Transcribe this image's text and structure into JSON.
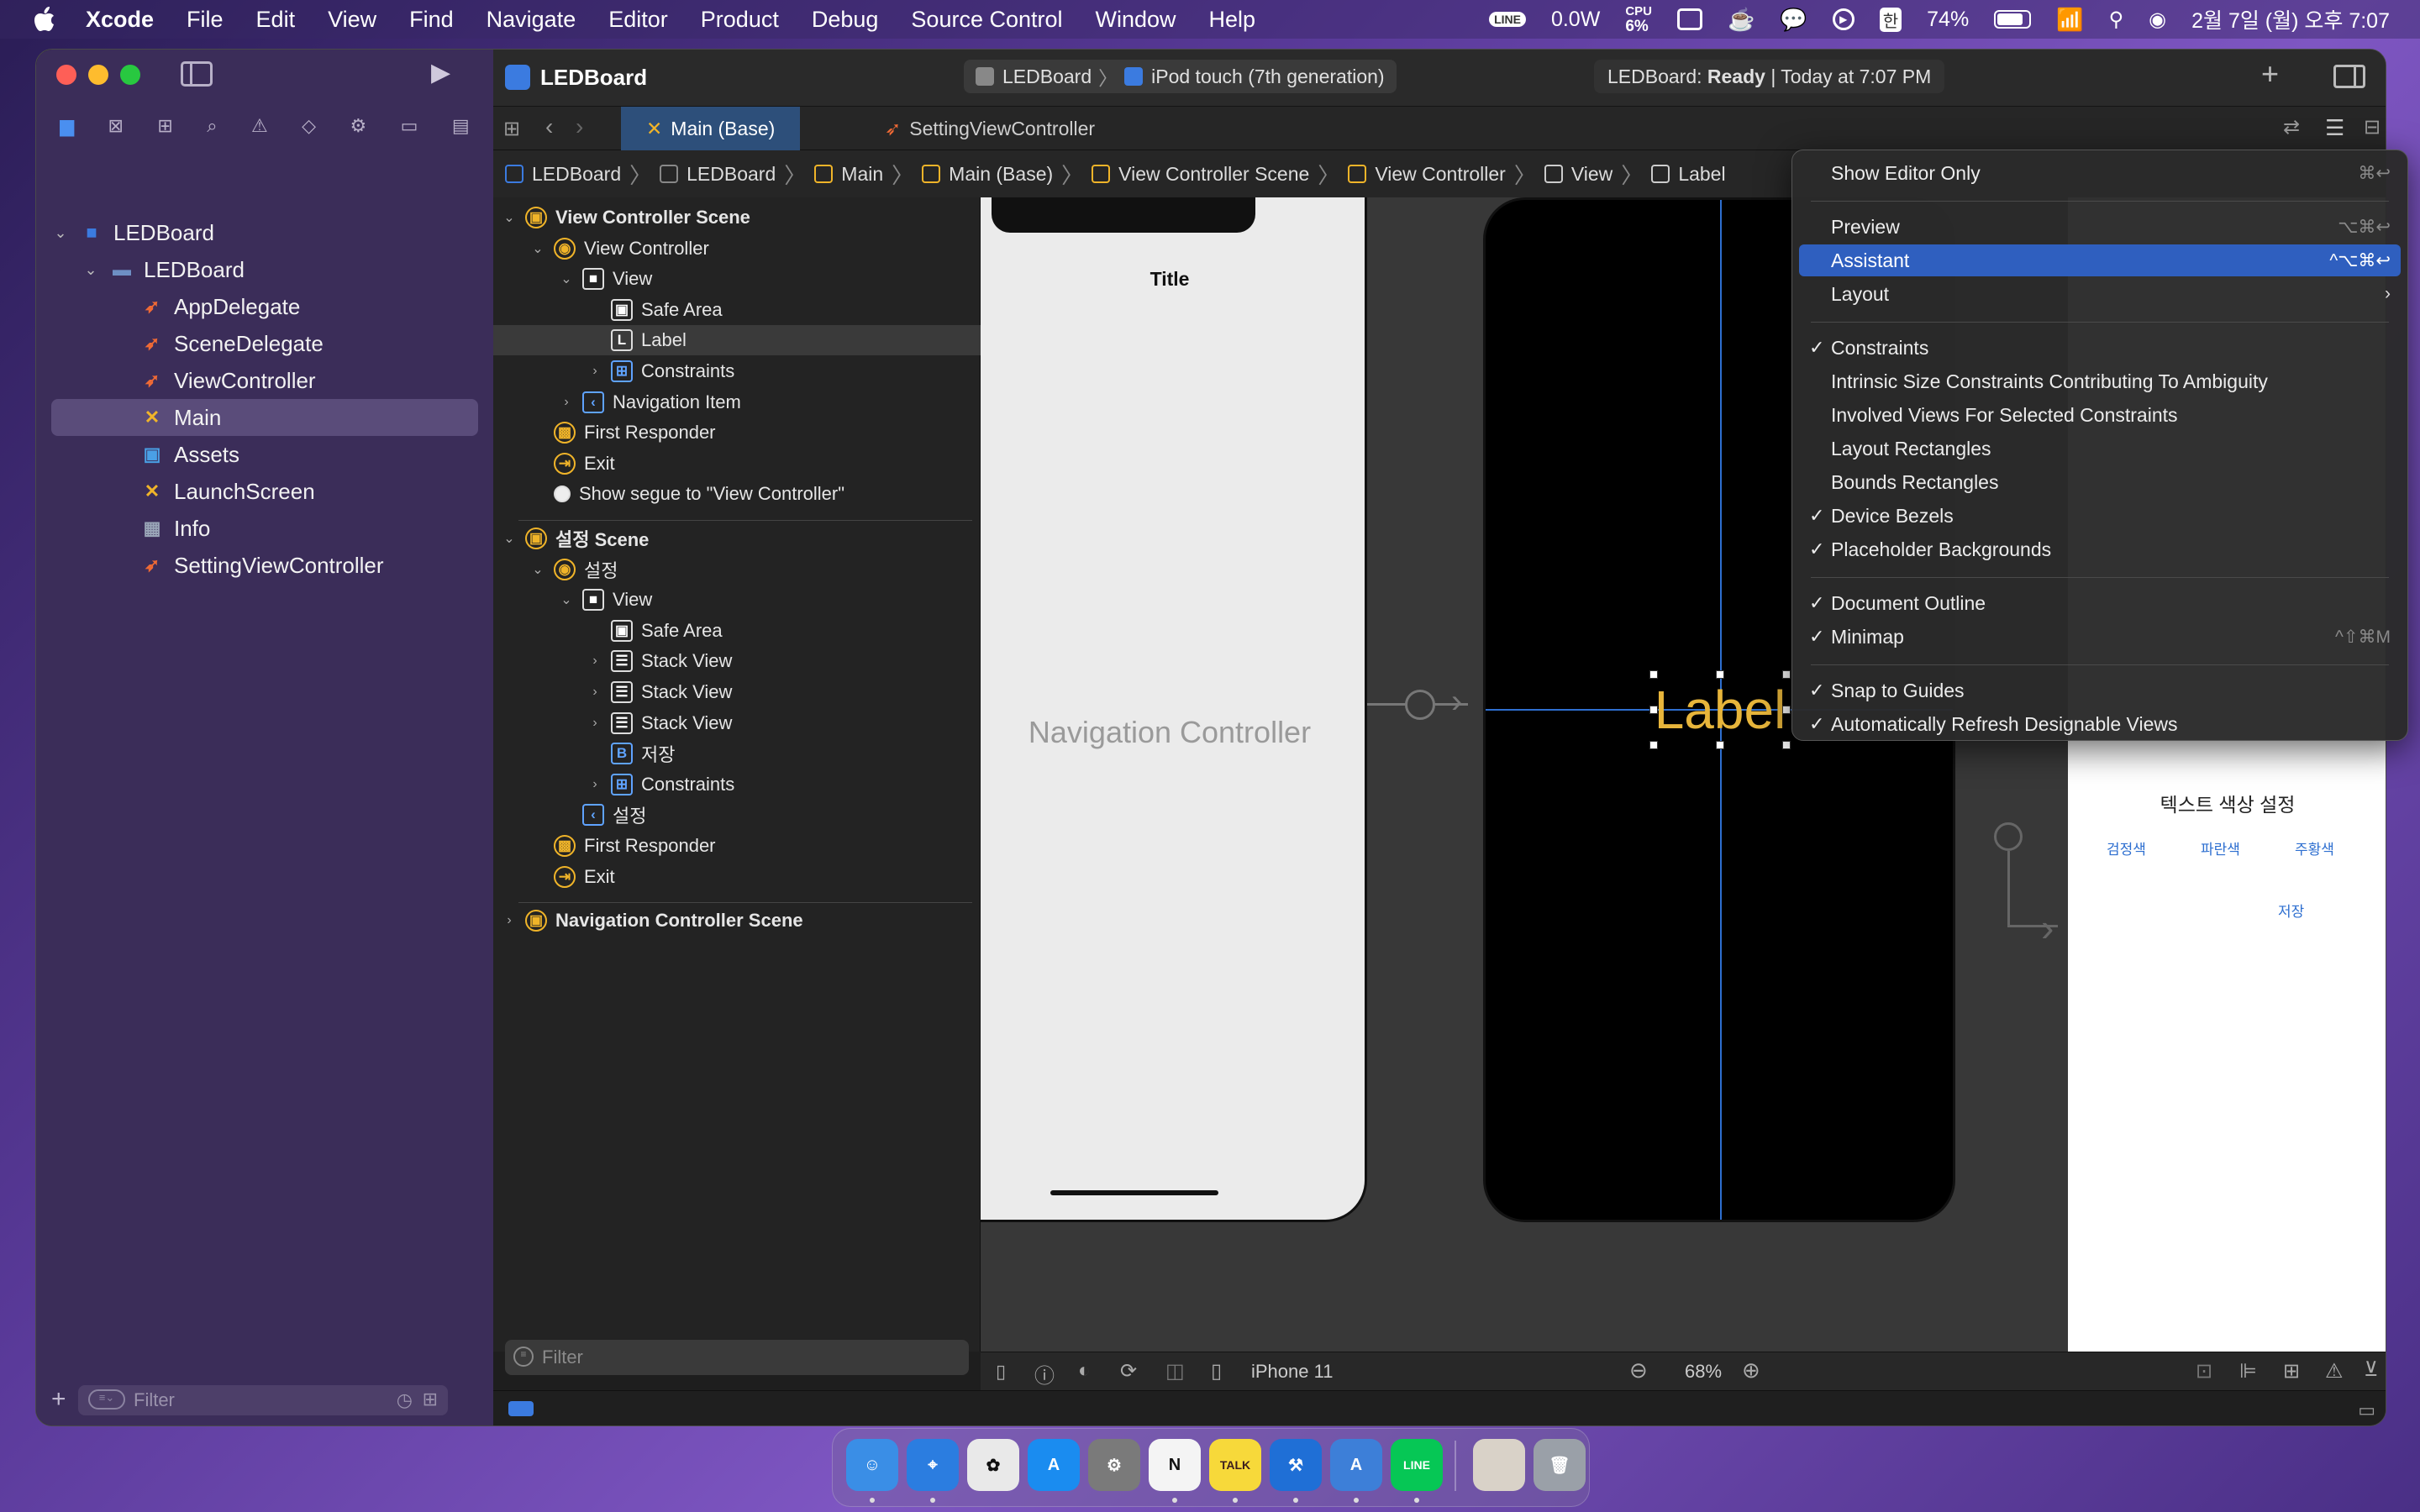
{
  "menubar": {
    "apple": "",
    "app": "Xcode",
    "items": [
      "File",
      "Edit",
      "View",
      "Find",
      "Navigate",
      "Editor",
      "Product",
      "Debug",
      "Source Control",
      "Window",
      "Help"
    ],
    "power": "0.0W",
    "cpu_label": "CPU",
    "cpu_value": "6%",
    "battery": "74%",
    "input": "한",
    "datetime": "2월 7일 (월) 오후 7:07"
  },
  "toolbar": {
    "project": "LEDBoard",
    "scheme": "LEDBoard",
    "device": "iPod touch (7th generation)",
    "status_prefix": "LEDBoard: ",
    "status_word": "Ready",
    "status_suffix": " | Today at 7:07 PM"
  },
  "navigator": {
    "items": [
      {
        "label": "LEDBoard",
        "kind": "project",
        "level": 0,
        "expanded": true
      },
      {
        "label": "LEDBoard",
        "kind": "folder",
        "level": 1,
        "expanded": true
      },
      {
        "label": "AppDelegate",
        "kind": "swift",
        "level": 2
      },
      {
        "label": "SceneDelegate",
        "kind": "swift",
        "level": 2
      },
      {
        "label": "ViewController",
        "kind": "swift",
        "level": 2
      },
      {
        "label": "Main",
        "kind": "storyboard",
        "level": 2,
        "selected": true
      },
      {
        "label": "Assets",
        "kind": "assets",
        "level": 2
      },
      {
        "label": "LaunchScreen",
        "kind": "storyboard",
        "level": 2
      },
      {
        "label": "Info",
        "kind": "plist",
        "level": 2
      },
      {
        "label": "SettingViewController",
        "kind": "swift",
        "level": 2
      }
    ],
    "filter_placeholder": "Filter"
  },
  "tabs": [
    {
      "label": "Main (Base)",
      "active": true
    },
    {
      "label": "SettingViewController",
      "active": false
    }
  ],
  "jumpbar": [
    "LEDBoard",
    "LEDBoard",
    "Main",
    "Main (Base)",
    "View Controller Scene",
    "View Controller",
    "View",
    "Label"
  ],
  "outline": {
    "rows": [
      {
        "label": "View Controller Scene",
        "level": 0,
        "bold": true,
        "icon": "scene",
        "disc": "open"
      },
      {
        "label": "View Controller",
        "level": 1,
        "icon": "vc",
        "disc": "open"
      },
      {
        "label": "View",
        "level": 2,
        "icon": "view",
        "disc": "open"
      },
      {
        "label": "Safe Area",
        "level": 3,
        "icon": "safe"
      },
      {
        "label": "Label",
        "level": 3,
        "icon": "label",
        "selected": true
      },
      {
        "label": "Constraints",
        "level": 3,
        "icon": "constraints",
        "disc": "closed"
      },
      {
        "label": "Navigation Item",
        "level": 2,
        "icon": "navitem",
        "disc": "closed"
      },
      {
        "label": "First Responder",
        "level": 1,
        "icon": "responder"
      },
      {
        "label": "Exit",
        "level": 1,
        "icon": "exit"
      },
      {
        "label": "Show segue to \"View Controller\"",
        "level": 1,
        "icon": "segue"
      },
      {
        "label": "설정 Scene",
        "level": 0,
        "bold": true,
        "icon": "scene",
        "disc": "open",
        "gap": true
      },
      {
        "label": "설정",
        "level": 1,
        "icon": "vc",
        "disc": "open"
      },
      {
        "label": "View",
        "level": 2,
        "icon": "view",
        "disc": "open"
      },
      {
        "label": "Safe Area",
        "level": 3,
        "icon": "safe"
      },
      {
        "label": "Stack View",
        "level": 3,
        "icon": "stack",
        "disc": "closed"
      },
      {
        "label": "Stack View",
        "level": 3,
        "icon": "stack",
        "disc": "closed"
      },
      {
        "label": "Stack View",
        "level": 3,
        "icon": "stack",
        "disc": "closed"
      },
      {
        "label": "저장",
        "level": 3,
        "icon": "button"
      },
      {
        "label": "Constraints",
        "level": 3,
        "icon": "constraints",
        "disc": "closed"
      },
      {
        "label": "설정",
        "level": 2,
        "icon": "navitem"
      },
      {
        "label": "First Responder",
        "level": 1,
        "icon": "responder"
      },
      {
        "label": "Exit",
        "level": 1,
        "icon": "exit"
      },
      {
        "label": "Navigation Controller Scene",
        "level": 0,
        "bold": true,
        "icon": "scene",
        "disc": "closed",
        "gap": true
      }
    ],
    "filter_placeholder": "Filter"
  },
  "canvas": {
    "nav_title": "Title",
    "nav_controller": "Navigation Controller",
    "label": "Label",
    "settings_title": "텍스트 색상 설정",
    "color_buttons": [
      "검정색",
      "파란색",
      "주황색"
    ],
    "save": "저장"
  },
  "bottombar": {
    "device": "iPhone 11",
    "zoom": "68%"
  },
  "menu": {
    "items": [
      {
        "label": "Show Editor Only",
        "checked": false,
        "shortcut": "⌘↩"
      },
      {
        "sep": true
      },
      {
        "label": "Preview",
        "checked": false,
        "shortcut": "⌥⌘↩"
      },
      {
        "label": "Assistant",
        "checked": false,
        "shortcut": "^⌥⌘↩",
        "highlight": true
      },
      {
        "label": "Layout",
        "checked": false,
        "submenu": true
      },
      {
        "sep": true
      },
      {
        "label": "Constraints",
        "checked": true
      },
      {
        "label": "Intrinsic Size Constraints Contributing To Ambiguity",
        "checked": false
      },
      {
        "label": "Involved Views For Selected Constraints",
        "checked": false
      },
      {
        "label": "Layout Rectangles",
        "checked": false
      },
      {
        "label": "Bounds Rectangles",
        "checked": false
      },
      {
        "label": "Device Bezels",
        "checked": true
      },
      {
        "label": "Placeholder Backgrounds",
        "checked": true
      },
      {
        "sep": true
      },
      {
        "label": "Document Outline",
        "checked": true
      },
      {
        "label": "Minimap",
        "checked": true,
        "shortcut": "^⇧⌘M"
      },
      {
        "sep": true
      },
      {
        "label": "Snap to Guides",
        "checked": true
      },
      {
        "label": "Automatically Refresh Designable Views",
        "checked": true
      }
    ]
  },
  "dock": [
    {
      "name": "Finder",
      "glyph": "☺",
      "color": "#3a8ee6",
      "running": true
    },
    {
      "name": "Safari",
      "glyph": "⌖",
      "color": "#2b7de0",
      "running": true
    },
    {
      "name": "Photos",
      "glyph": "✿",
      "color": "#e9e9e9",
      "running": false
    },
    {
      "name": "App Store",
      "glyph": "A",
      "color": "#1a8cf0",
      "running": false
    },
    {
      "name": "System Preferences",
      "glyph": "⚙",
      "color": "#7a7a7a",
      "running": false
    },
    {
      "name": "Notion",
      "glyph": "N",
      "color": "#f4f4f4",
      "running": true
    },
    {
      "name": "KakaoTalk",
      "glyph": "TALK",
      "color": "#f7d93a",
      "running": true
    },
    {
      "name": "Xcode",
      "glyph": "⚒",
      "color": "#1f6fd6",
      "running": true
    },
    {
      "name": "Simulator",
      "glyph": "A",
      "color": "#3d7fd8",
      "running": true
    },
    {
      "name": "LINE",
      "glyph": "LINE",
      "color": "#06c755",
      "running": true
    },
    {
      "name": "Photo",
      "glyph": "",
      "color": "#d9d2c8",
      "running": false
    },
    {
      "name": "Trash",
      "glyph": "🗑",
      "color": "#9aa0a8",
      "running": false
    }
  ]
}
